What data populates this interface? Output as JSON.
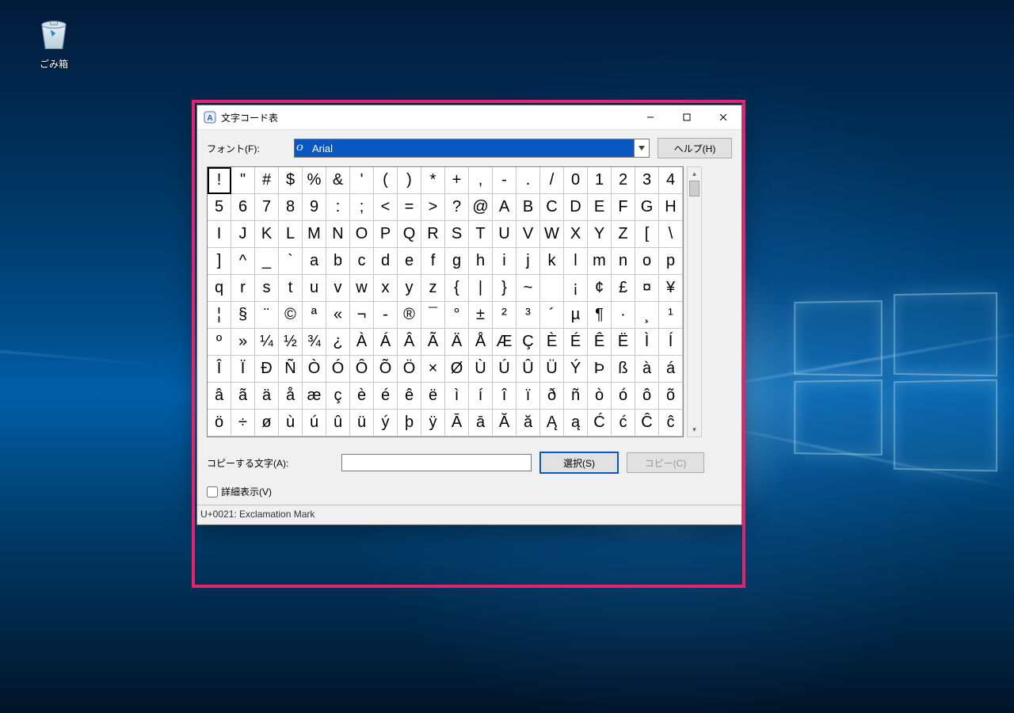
{
  "desktop": {
    "recycle_bin_label": "ごみ箱"
  },
  "window": {
    "title": "文字コード表",
    "font_label": "フォント(F):",
    "font_value": "Arial",
    "help_button": "ヘルプ(H)",
    "copy_label": "コピーする文字(A):",
    "copy_value": "",
    "select_button": "選択(S)",
    "copy_button": "コピー(C)",
    "advanced_label": "詳細表示(V)",
    "advanced_checked": false,
    "status": "U+0021: Exclamation Mark",
    "selected_index": 0,
    "chars": [
      "!",
      "\"",
      "#",
      "$",
      "%",
      "&",
      "'",
      "(",
      ")",
      "*",
      "+",
      ",",
      "-",
      ".",
      "/",
      "0",
      "1",
      "2",
      "3",
      "4",
      "5",
      "6",
      "7",
      "8",
      "9",
      ":",
      ";",
      "<",
      "=",
      ">",
      "?",
      "@",
      "A",
      "B",
      "C",
      "D",
      "E",
      "F",
      "G",
      "H",
      "I",
      "J",
      "K",
      "L",
      "M",
      "N",
      "O",
      "P",
      "Q",
      "R",
      "S",
      "T",
      "U",
      "V",
      "W",
      "X",
      "Y",
      "Z",
      "[",
      "\\",
      "]",
      "^",
      "_",
      "`",
      "a",
      "b",
      "c",
      "d",
      "e",
      "f",
      "g",
      "h",
      "i",
      "j",
      "k",
      "l",
      "m",
      "n",
      "o",
      "p",
      "q",
      "r",
      "s",
      "t",
      "u",
      "v",
      "w",
      "x",
      "y",
      "z",
      "{",
      "|",
      "}",
      "~",
      " ",
      "¡",
      "¢",
      "£",
      "¤",
      "¥",
      "¦",
      "§",
      "¨",
      "©",
      "ª",
      "«",
      "¬",
      "-",
      "®",
      "¯",
      "°",
      "±",
      "²",
      "³",
      "´",
      "µ",
      "¶",
      "·",
      "¸",
      "¹",
      "º",
      "»",
      "¼",
      "½",
      "¾",
      "¿",
      "À",
      "Á",
      "Â",
      "Ã",
      "Ä",
      "Å",
      "Æ",
      "Ç",
      "È",
      "É",
      "Ê",
      "Ë",
      "Ì",
      "Í",
      "Î",
      "Ï",
      "Ð",
      "Ñ",
      "Ò",
      "Ó",
      "Ô",
      "Õ",
      "Ö",
      "×",
      "Ø",
      "Ù",
      "Ú",
      "Û",
      "Ü",
      "Ý",
      "Þ",
      "ß",
      "à",
      "á",
      "â",
      "ã",
      "ä",
      "å",
      "æ",
      "ç",
      "è",
      "é",
      "ê",
      "ë",
      "ì",
      "í",
      "î",
      "ï",
      "ð",
      "ñ",
      "ò",
      "ó",
      "ô",
      "õ",
      "ö",
      "÷",
      "ø",
      "ù",
      "ú",
      "û",
      "ü",
      "ý",
      "þ",
      "ÿ",
      "Ā",
      "ā",
      "Ă",
      "ă",
      "Ą",
      "ą",
      "Ć",
      "ć",
      "Ĉ",
      "ĉ"
    ]
  }
}
